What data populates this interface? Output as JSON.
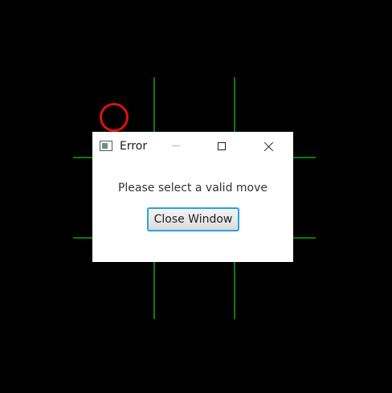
{
  "colors": {
    "background": "#000000",
    "grid_line": "#0a7a0a",
    "o_marker": "#e01010",
    "dialog_background": "#ffffff",
    "button_focus_border": "#2aa3dc"
  },
  "board": {
    "marks": [
      {
        "cell": "top-left",
        "symbol": "O"
      }
    ]
  },
  "dialog": {
    "title": "Error",
    "icon": "window-app-icon",
    "controls": [
      "minimize-icon",
      "maximize-icon",
      "close-icon"
    ],
    "message": "Please select a valid move",
    "button_label": "Close Window"
  }
}
